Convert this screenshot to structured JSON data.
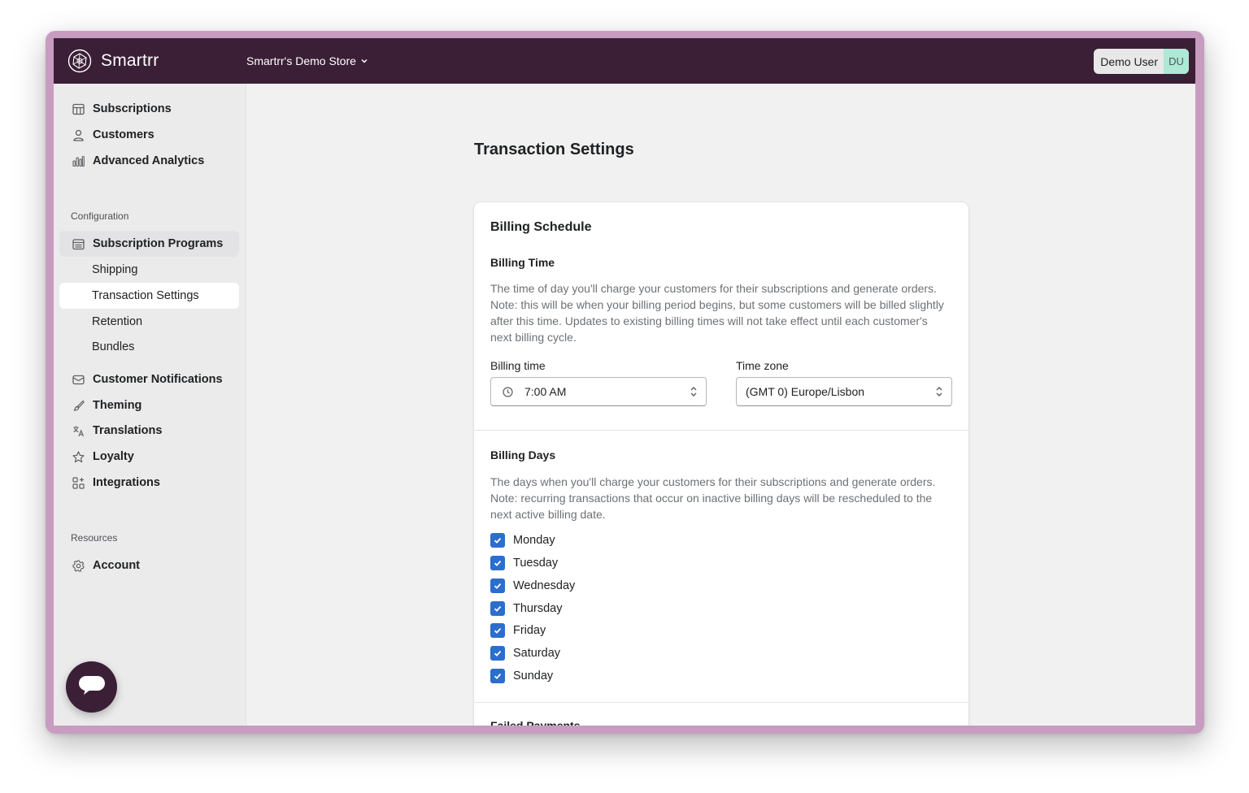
{
  "app": {
    "brand": "Smartrr",
    "store": "Smartrr's Demo Store"
  },
  "user": {
    "name": "Demo User",
    "initials": "DU"
  },
  "sidebar": {
    "main_items": [
      {
        "label": "Subscriptions",
        "icon": "table-icon"
      },
      {
        "label": "Customers",
        "icon": "person-icon"
      },
      {
        "label": "Advanced Analytics",
        "icon": "bar-chart-icon"
      }
    ],
    "configuration_label": "Configuration",
    "config_parent": {
      "label": "Subscription Programs",
      "icon": "calendar-icon"
    },
    "config_sub_items": [
      "Shipping",
      "Transaction Settings",
      "Retention",
      "Bundles"
    ],
    "selected_sub_item": "Transaction Settings",
    "config_items": [
      {
        "label": "Customer Notifications",
        "icon": "envelope-icon"
      },
      {
        "label": "Theming",
        "icon": "paint-brush-icon"
      },
      {
        "label": "Translations",
        "icon": "translate-icon"
      },
      {
        "label": "Loyalty",
        "icon": "star-icon"
      },
      {
        "label": "Integrations",
        "icon": "apps-icon"
      }
    ],
    "resources_label": "Resources",
    "resources_items": [
      {
        "label": "Account",
        "icon": "gear-icon"
      }
    ]
  },
  "main": {
    "page_title": "Transaction Settings",
    "billing_schedule": {
      "title": "Billing Schedule",
      "billing_time_heading": "Billing Time",
      "billing_time_desc": "The time of day you'll charge your customers for their subscriptions and generate orders. Note: this will be when your billing period begins, but some customers will be billed slightly after this time. Updates to existing billing times will not take effect until each customer's next billing cycle.",
      "billing_time_label": "Billing time",
      "billing_time_value": "7:00 AM",
      "time_zone_label": "Time zone",
      "time_zone_value": "(GMT 0) Europe/Lisbon",
      "billing_days_heading": "Billing Days",
      "billing_days_desc": "The days when you'll charge your customers for their subscriptions and generate orders. Note: recurring transactions that occur on inactive billing days will be rescheduled to the next active billing date.",
      "days": [
        {
          "label": "Monday",
          "checked": true
        },
        {
          "label": "Tuesday",
          "checked": true
        },
        {
          "label": "Wednesday",
          "checked": true
        },
        {
          "label": "Thursday",
          "checked": true
        },
        {
          "label": "Friday",
          "checked": true
        },
        {
          "label": "Saturday",
          "checked": true
        },
        {
          "label": "Sunday",
          "checked": true
        }
      ],
      "next_section_heading": "Failed Payments"
    }
  },
  "colors": {
    "topbar": "#3b1f36",
    "accent_checkbox": "#2c6ecb",
    "initials_bg": "#aee9d7"
  }
}
